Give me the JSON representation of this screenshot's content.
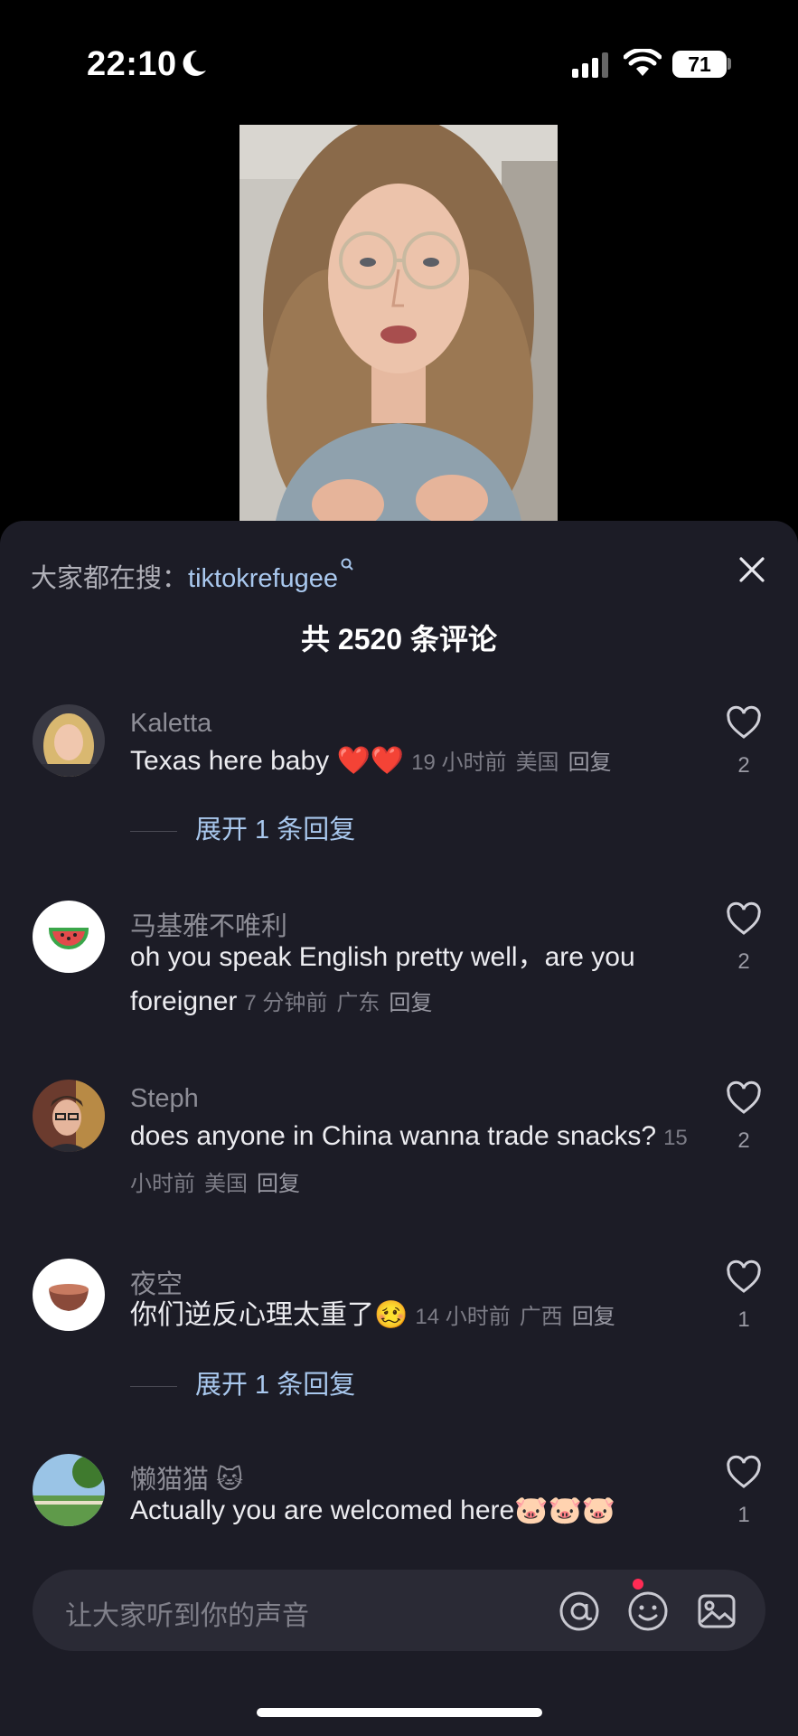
{
  "status_bar": {
    "time": "22:10",
    "battery": "71"
  },
  "sheet": {
    "search_prefix": "大家都在搜：",
    "search_topic": "tiktokrefugee",
    "comment_count_title": "共 2520 条评论"
  },
  "comments": [
    {
      "user": "Kaletta",
      "text": "Texas here baby ❤️❤️",
      "time": "19 小时前",
      "location": "美国",
      "reply": "回复",
      "likes": "2",
      "expand": "展开 1 条回复"
    },
    {
      "user": "马基雅不唯利",
      "text": "oh  you speak English pretty well，are you foreigner",
      "time": "7 分钟前",
      "location": "广东",
      "reply": "回复",
      "likes": "2"
    },
    {
      "user": "Steph",
      "text": "does anyone in China wanna trade snacks?",
      "time": "15 小时前",
      "location": "美国",
      "reply": "回复",
      "likes": "2"
    },
    {
      "user": "夜空",
      "text": "你们逆反心理太重了🥴",
      "time": "14 小时前",
      "location": "广西",
      "reply": "回复",
      "likes": "1",
      "expand": "展开 1 条回复"
    },
    {
      "user": "懒猫猫 🐱",
      "text": "Actually you are welcomed here🐷🐷🐷",
      "likes": "1"
    }
  ],
  "input": {
    "placeholder": "让大家听到你的声音"
  },
  "icons": {
    "moon": "moon-icon",
    "signal": "cellular-signal-icon",
    "wifi": "wifi-icon",
    "close": "close-icon",
    "like": "heart-outline-icon",
    "mention": "at-sign-icon",
    "emoji": "emoji-face-icon",
    "image": "image-icon"
  },
  "colors": {
    "sheet_bg": "#1c1c26",
    "topic_link": "#a9c8ee",
    "notification_dot": "#ff2b54"
  }
}
